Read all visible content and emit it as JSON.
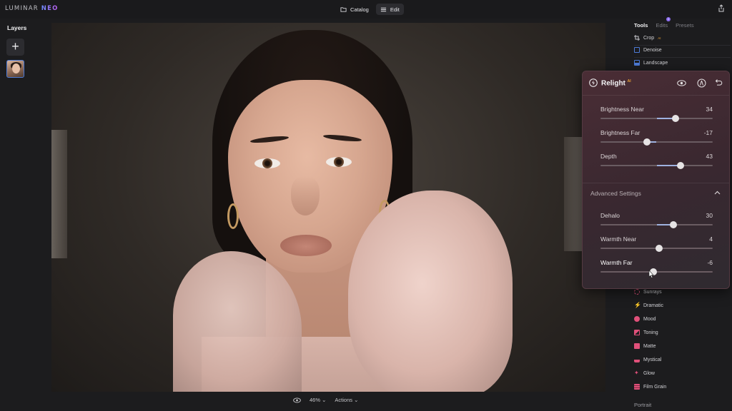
{
  "app": {
    "logo_main": "LUMINAR ",
    "logo_accent": "NEO"
  },
  "topnav": {
    "catalog": "Catalog",
    "edit": "Edit"
  },
  "layers": {
    "title": "Layers",
    "add": "+"
  },
  "bottombar": {
    "zoom": "46%",
    "actions": "Actions"
  },
  "tabs": {
    "tools": "Tools",
    "edits": "Edits",
    "edits_badge": "2",
    "presets": "Presets"
  },
  "tools_top": [
    {
      "label": "Crop",
      "icon": "crop-icon",
      "ai": "AI"
    },
    {
      "label": "Denoise",
      "icon": "denoise-icon"
    },
    {
      "label": "Landscape",
      "icon": "landscape-icon"
    }
  ],
  "relight": {
    "title": "Relight",
    "ai": "AI",
    "sliders": [
      {
        "label": "Brightness Near",
        "value": "34",
        "num": 34
      },
      {
        "label": "Brightness Far",
        "value": "-17",
        "num": -17
      },
      {
        "label": "Depth",
        "value": "43",
        "num": 43
      }
    ],
    "advanced": "Advanced Settings",
    "adv_sliders": [
      {
        "label": "Dehalo",
        "value": "30",
        "num": 30
      },
      {
        "label": "Warmth Near",
        "value": "4",
        "num": 4
      },
      {
        "label": "Warmth Far",
        "value": "-6",
        "num": -6
      }
    ]
  },
  "tools_bottom": [
    {
      "label": "Sunrays",
      "icon": "sunrays-icon",
      "color": "#e0507a"
    },
    {
      "label": "Dramatic",
      "icon": "dramatic-icon",
      "color": "#e0507a"
    },
    {
      "label": "Mood",
      "icon": "mood-icon",
      "color": "#e0507a"
    },
    {
      "label": "Toning",
      "icon": "toning-icon",
      "color": "#e0507a"
    },
    {
      "label": "Matte",
      "icon": "matte-icon",
      "color": "#e0507a"
    },
    {
      "label": "Mystical",
      "icon": "mystical-icon",
      "color": "#e0507a"
    },
    {
      "label": "Glow",
      "icon": "glow-icon",
      "color": "#e0507a"
    },
    {
      "label": "Film Grain",
      "icon": "film-grain-icon",
      "color": "#e0507a"
    }
  ],
  "section_portrait": "Portrait",
  "colors": {
    "accent": "#4d7bd6",
    "ai_badge": "#e6a035",
    "creative": "#e0507a",
    "slider_fill": "#9fb2e0"
  }
}
